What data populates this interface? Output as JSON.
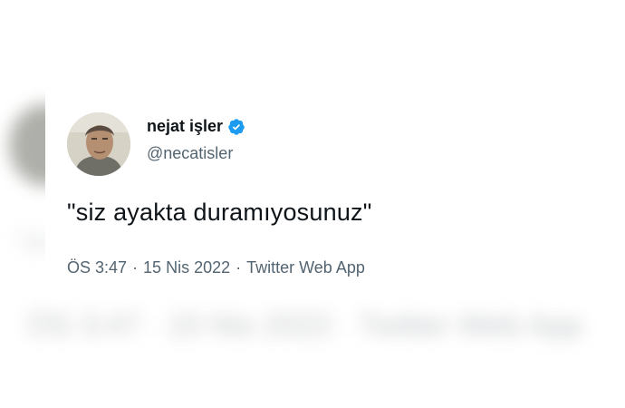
{
  "tweet": {
    "display_name": "nejat işler",
    "handle": "@necatisler",
    "text": "\"siz ayakta duramıyosunuz\"",
    "time": "ÖS 3:47",
    "date": "15 Nis 2022",
    "source": "Twitter Web App",
    "separator": "·",
    "verified": true
  },
  "icons": {
    "verified": "verified-badge-icon",
    "avatar": "profile-photo"
  },
  "colors": {
    "verified_blue": "#1d9bf0",
    "text_primary": "#0f1419",
    "text_secondary": "#536471",
    "background": "#ffffff"
  }
}
